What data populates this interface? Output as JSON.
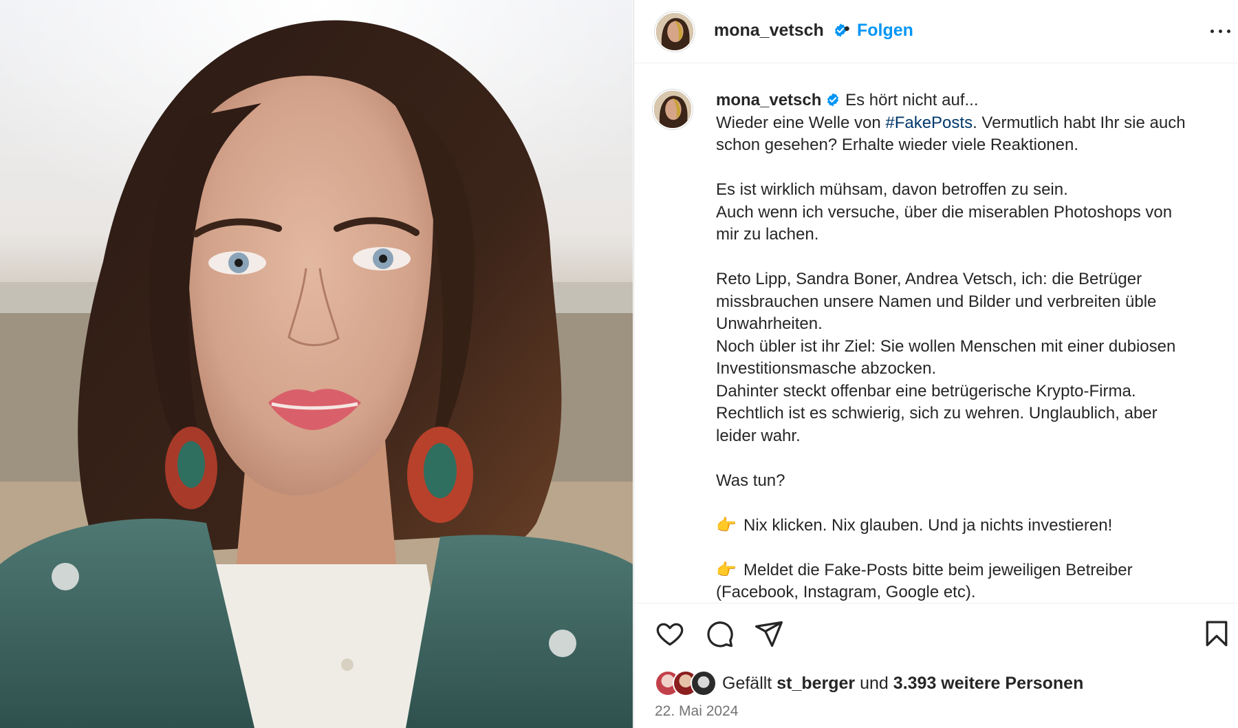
{
  "post": {
    "username": "mona_vetsch",
    "follow_label": "Folgen",
    "separator": "•",
    "caption": {
      "first_line": "Es hört nicht auf...",
      "line_2_before": "Wieder eine Welle von ",
      "hashtag": "#FakePosts",
      "line_2_after": ". Vermutlich habt Ihr sie auch",
      "line_3": "schon gesehen? Erhalte wieder viele Reaktionen.",
      "line_5": "Es ist wirklich mühsam, davon betroffen zu sein.",
      "line_6": "Auch wenn ich versuche, über die miserablen Photoshops von",
      "line_7": "mir zu lachen.",
      "line_9": "Reto Lipp, Sandra Boner, Andrea Vetsch, ich: die Betrüger",
      "line_10": "missbrauchen unsere Namen und Bilder und verbreiten üble",
      "line_11": "Unwahrheiten.",
      "line_12": "Noch übler ist ihr Ziel: Sie wollen Menschen mit einer dubiosen",
      "line_13": "Investitionsmasche abzocken.",
      "line_14": "Dahinter steckt offenbar eine betrügerische Krypto-Firma.",
      "line_15": "Rechtlich ist es schwierig, sich zu wehren. Unglaublich, aber",
      "line_16": "leider wahr.",
      "line_18": "Was tun?",
      "hand_emoji": "👉",
      "line_20": "Nix klicken. Nix glauben. Und ja nichts investieren!",
      "line_22": "Meldet die Fake-Posts bitte beim jeweiligen Betreiber",
      "line_23": "(Facebook, Instagram, Google etc)."
    },
    "likes": {
      "prefix": "Gefällt ",
      "user": "st_berger",
      "middle": " und ",
      "count_text": "3.393 weitere Personen"
    },
    "date": "22. Mai 2024"
  },
  "icons": {
    "verified": "verified-badge-icon",
    "more": "more-options-icon",
    "like": "heart-icon",
    "comment": "comment-icon",
    "share": "paper-plane-icon",
    "save": "bookmark-icon"
  },
  "colors": {
    "accent": "#0095f6",
    "hashtag": "#00376b",
    "text": "#262626",
    "muted": "#737373"
  }
}
